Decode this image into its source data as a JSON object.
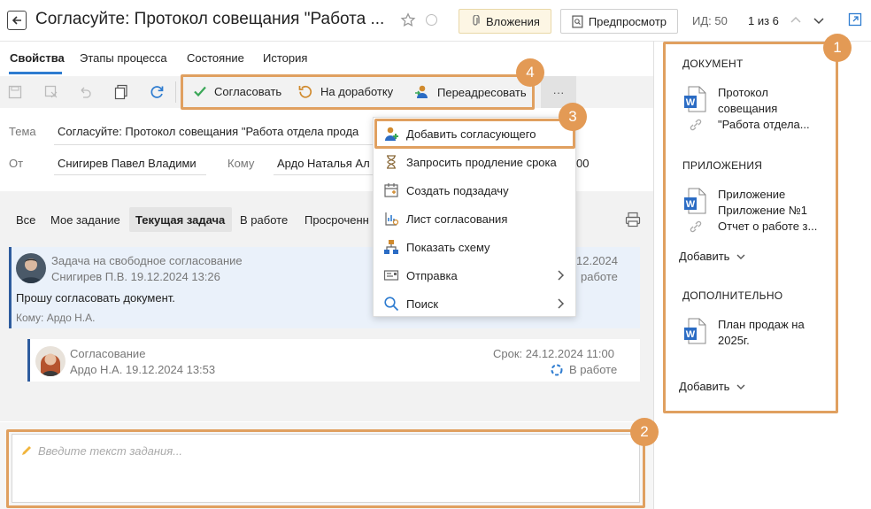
{
  "header": {
    "title": "Согласуйте: Протокол совещания \"Работа ...",
    "attachments_label": "Вложения",
    "preview_label": "Предпросмотр",
    "id_label": "ИД: 50",
    "pager_label": "1 из 6"
  },
  "tabs": [
    "Свойства",
    "Этапы процесса",
    "Состояние",
    "История"
  ],
  "toolbar": {
    "approve_label": "Согласовать",
    "rework_label": "На доработку",
    "redirect_label": "Переадресовать",
    "more_label": "···"
  },
  "fields": {
    "subject_label": "Тема",
    "subject_value": "Согласуйте: Протокол совещания \"Работа отдела прода",
    "from_label": "От",
    "from_value": "Снигирев Павел Владими",
    "to_label": "Кому",
    "to_value": "Ардо Наталья Ал",
    "to_tail": "00"
  },
  "filters": [
    "Все",
    "Мое задание",
    "Текущая задача",
    "В работе",
    "Просроченн"
  ],
  "task1": {
    "type": "Задача на свободное согласование",
    "author_date": "Снигирев П.В.  19.12.2024 13:26",
    "date_right": "12.2024",
    "status": "работе",
    "message": "Прошу согласовать документ.",
    "to_line": "Кому: Ардо Н.А."
  },
  "task2": {
    "type": "Согласование",
    "author_date": "Ардо Н.А.  19.12.2024 13:53",
    "deadline": "Срок: 24.12.2024 11:00",
    "status": "В работе"
  },
  "menu": {
    "items": [
      {
        "label": "Добавить согласующего",
        "icon": "add-user-icon"
      },
      {
        "label": "Запросить продление срока",
        "icon": "hourglass-icon"
      },
      {
        "label": "Создать подзадачу",
        "icon": "calendar-icon"
      },
      {
        "label": "Лист согласования",
        "icon": "approval-sheet-icon"
      },
      {
        "label": "Показать схему",
        "icon": "scheme-icon"
      },
      {
        "label": "Отправка",
        "icon": "send-icon"
      },
      {
        "label": "Поиск",
        "icon": "search-icon"
      }
    ]
  },
  "input": {
    "placeholder": "Введите текст задания..."
  },
  "panel": {
    "document_head": "ДОКУМЕНТ",
    "document_lines": [
      "Протокол",
      "совещания",
      "\"Работа отдела..."
    ],
    "attachments_head": "ПРИЛОЖЕНИЯ",
    "attachment_lines": [
      "Приложение",
      "Приложение №1",
      "Отчет о работе з..."
    ],
    "add_label": "Добавить",
    "additional_head": "ДОПОЛНИТЕЛЬНО",
    "additional_lines": [
      "План продаж на",
      "2025г."
    ],
    "add_label2": "Добавить"
  },
  "callouts": [
    "1",
    "2",
    "3",
    "4"
  ],
  "colors": {
    "accent": "#2e7cd0",
    "callout": "#e39a55",
    "approve_green": "#3aa757",
    "word_blue": "#2b6cc4"
  }
}
